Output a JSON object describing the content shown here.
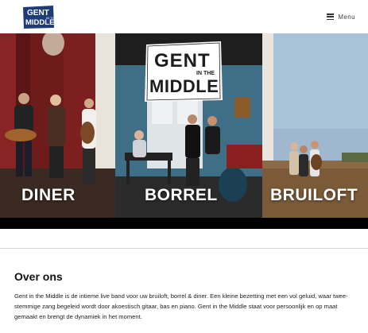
{
  "header": {
    "logo_text": "GENT IN THE MIDDLE",
    "menu_label": "Menu"
  },
  "hero": {
    "logo_text_top": "GENT",
    "logo_text_small": "IN THE",
    "logo_text_bottom": "MIDDLE",
    "panels": [
      {
        "label": "DINER"
      },
      {
        "label": "BORREL"
      },
      {
        "label": "BRUILOFT"
      }
    ]
  },
  "about": {
    "heading": "Over ons",
    "body": "Gent in the Middle is de intieme live band voor uw bruiloft, borrel & diner. Een kleine bezetting met een vol geluid, waar twee-stemmige zang begeleid wordt door akoestisch gitaar, bas en piano. Gent in the Middle staat voor persoonlijk en op maat gemaakt en brengt de dynamiek in het moment."
  },
  "colors": {
    "brand_navy": "#1f3c78",
    "text": "#1a1a1a",
    "hero_bar": "#000000"
  }
}
